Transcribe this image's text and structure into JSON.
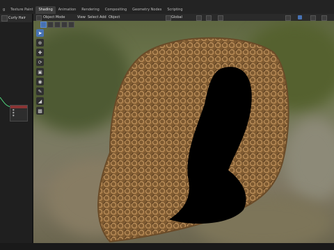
{
  "workspace_tabs": [
    "g",
    "Texture Paint",
    "Shading",
    "Animation",
    "Rendering",
    "Compositing",
    "Geometry Nodes",
    "Scripting"
  ],
  "active_tab_index": 2,
  "left_panel": {
    "object_name": "Curly Hair"
  },
  "viewport_header": {
    "mode_label": "Object Mode",
    "menus": [
      "View",
      "Select",
      "Add",
      "Object"
    ],
    "transform_orientation": "Global"
  },
  "tools": [
    "cursor-icon",
    "select-icon",
    "move-icon",
    "rotate-icon",
    "scale-icon",
    "transform-icon",
    "annotate-icon",
    "measure-icon",
    "add-cube-icon"
  ],
  "colors": {
    "accent": "#4772b3",
    "header": "#2a2a2a",
    "panel": "#1f1f1f",
    "hair": "#8a6438",
    "mask": "#000000"
  }
}
